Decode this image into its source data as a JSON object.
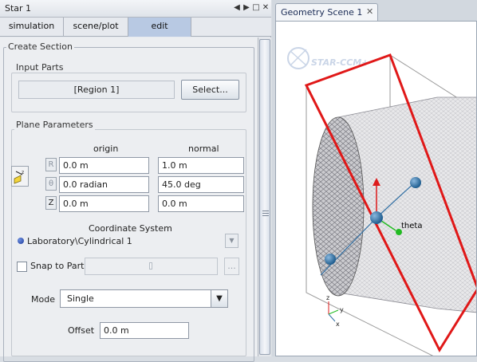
{
  "window": {
    "title": "Star 1"
  },
  "tabs": [
    {
      "label": "simulation",
      "active": false
    },
    {
      "label": "scene/plot",
      "active": false
    },
    {
      "label": "edit",
      "active": true
    }
  ],
  "create_section": {
    "title": "Create Section",
    "input_parts": {
      "title": "Input Parts",
      "value": "[Region 1]",
      "select_label": "Select..."
    },
    "plane_parameters": {
      "title": "Plane Parameters",
      "origin_header": "origin",
      "normal_header": "normal",
      "rows": [
        {
          "axis": "R",
          "enabled": false,
          "origin": "0.0 m",
          "normal": "1.0 m"
        },
        {
          "axis": "θ",
          "enabled": false,
          "origin": "0.0 radian",
          "normal": "45.0 deg"
        },
        {
          "axis": "Z",
          "enabled": true,
          "origin": "0.0 m",
          "normal": "0.0 m"
        }
      ]
    },
    "coordinate_system": {
      "title": "Coordinate System",
      "value": "Laboratory\\Cylindrical 1"
    },
    "snap_to_part": {
      "label": "Snap to Part",
      "checked": false,
      "browse_label": "..."
    },
    "mode": {
      "label": "Mode",
      "value": "Single"
    },
    "offset": {
      "label": "Offset",
      "value": "0.0 m"
    }
  },
  "scene": {
    "tab_label": "Geometry Scene 1",
    "watermark": "STAR-CCM+",
    "axis_label": "theta",
    "triad_labels": {
      "z": "z",
      "y": "y",
      "x": "x"
    }
  },
  "colors": {
    "selected_tab": "#b8c9e3",
    "plane_outline": "#e01818",
    "mesh_fill": "#c8c8cc",
    "widget_blue": "#2f6ea3",
    "arrow_red": "#dd1c1c",
    "arrow_green": "#22bb22"
  }
}
